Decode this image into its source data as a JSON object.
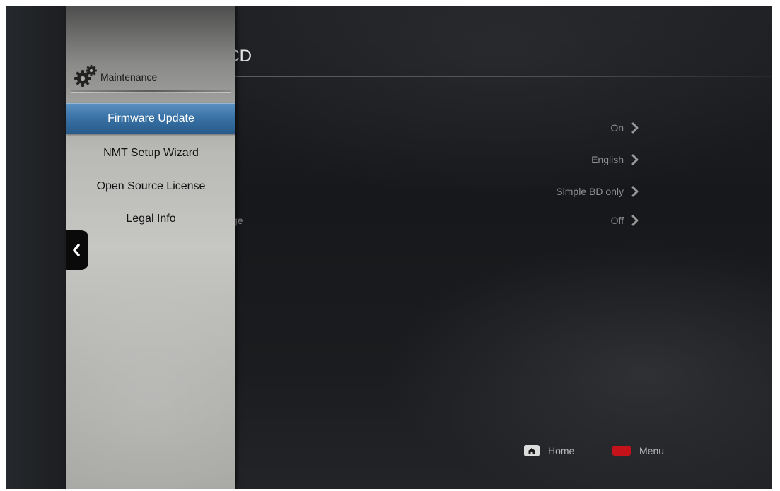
{
  "page": {
    "title_visible": "io CD"
  },
  "settings": [
    {
      "label": "",
      "value": "On"
    },
    {
      "label": "",
      "value": "English"
    },
    {
      "label": "",
      "value": "Simple BD only"
    },
    {
      "label": "ge",
      "value": "Off"
    }
  ],
  "side_panel": {
    "heading": "Maintenance",
    "heading_icon": "gear-icon",
    "items": [
      {
        "label": "Firmware Update",
        "selected": true
      },
      {
        "label": "NMT Setup Wizard",
        "selected": false
      },
      {
        "label": "Open Source License",
        "selected": false
      },
      {
        "label": "Legal Info",
        "selected": false
      }
    ],
    "collapse_icon": "chevron-left-icon"
  },
  "footer": {
    "home_label": "Home",
    "home_icon": "home-icon",
    "menu_label": "Menu",
    "menu_key_color": "#c4121a"
  },
  "colors": {
    "selection_blue": "#3a73a7",
    "background": "#1a1c1f"
  }
}
